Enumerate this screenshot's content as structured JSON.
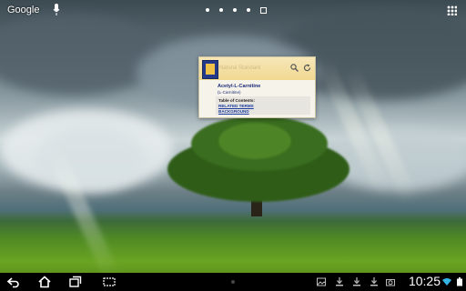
{
  "top_bar": {
    "google_label": "Google"
  },
  "widget": {
    "search_placeholder": "Natural Standard",
    "entry_title": "Acetyl-L-Carnitine",
    "entry_subtitle": "(L-Carnitine)",
    "toc_title": "Table of Contents:",
    "toc_links": [
      "RELATED TERMS",
      "BACKGROUND"
    ]
  },
  "status_bar": {
    "time": "10:25"
  },
  "colors": {
    "accent": "#1d2c7a",
    "widget_header": "#f1d991"
  }
}
